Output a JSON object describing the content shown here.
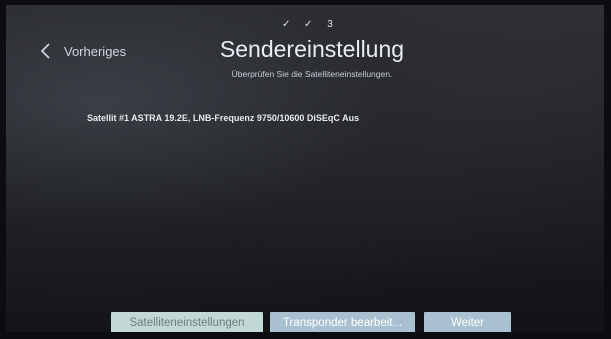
{
  "steps": [
    "✓",
    "✓",
    "3"
  ],
  "nav": {
    "back_label": "Vorheriges"
  },
  "header": {
    "title": "Sendereinstellung",
    "subtitle": "Überprüfen Sie die Satelliteneinstellungen."
  },
  "satellite": {
    "info": "Satellit #1 ASTRA 19.2E, LNB-Frequenz 9750/10600 DiSEqC Aus"
  },
  "buttons": {
    "satellite_settings": "Satelliteneinstellungen",
    "transponder": "Transponder bearbeit...",
    "next": "Weiter"
  },
  "colors": {
    "button_selected": "#c2d8d4",
    "button_default": "#a9c0d0"
  }
}
